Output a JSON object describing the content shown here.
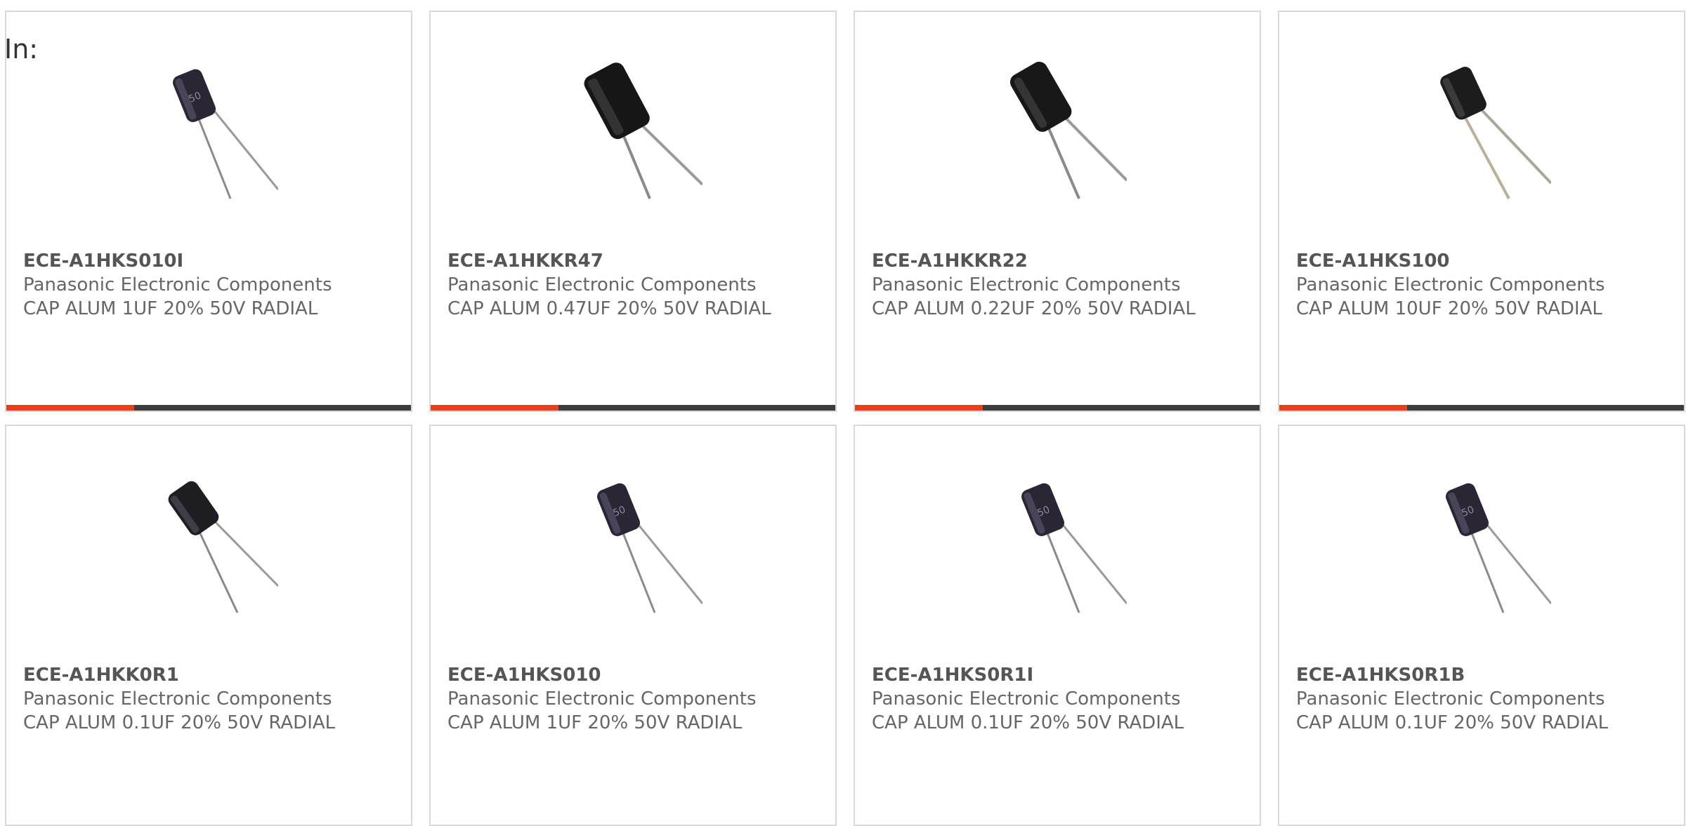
{
  "header": {
    "in_label": "In:"
  },
  "colors": {
    "accent": "#e8401c",
    "bar": "#3d3d3d",
    "border": "#d9d9d9",
    "text": "#666666"
  },
  "products": [
    {
      "part_number": "ECE-A1HKS010I",
      "manufacturer": "Panasonic Electronic Components",
      "description": "CAP ALUM 1UF 20% 50V RADIAL",
      "icon": "capacitor-icon"
    },
    {
      "part_number": "ECE-A1HKKR47",
      "manufacturer": "Panasonic Electronic Components",
      "description": "CAP ALUM 0.47UF 20% 50V RADIAL",
      "icon": "capacitor-icon"
    },
    {
      "part_number": "ECE-A1HKKR22",
      "manufacturer": "Panasonic Electronic Components",
      "description": "CAP ALUM 0.22UF 20% 50V RADIAL",
      "icon": "capacitor-icon"
    },
    {
      "part_number": "ECE-A1HKS100",
      "manufacturer": "Panasonic Electronic Components",
      "description": "CAP ALUM 10UF 20% 50V RADIAL",
      "icon": "capacitor-icon"
    },
    {
      "part_number": "ECE-A1HKK0R1",
      "manufacturer": "Panasonic Electronic Components",
      "description": "CAP ALUM 0.1UF 20% 50V RADIAL",
      "icon": "capacitor-icon"
    },
    {
      "part_number": "ECE-A1HKS010",
      "manufacturer": "Panasonic Electronic Components",
      "description": "CAP ALUM 1UF 20% 50V RADIAL",
      "icon": "capacitor-icon"
    },
    {
      "part_number": "ECE-A1HKS0R1I",
      "manufacturer": "Panasonic Electronic Components",
      "description": "CAP ALUM 0.1UF 20% 50V RADIAL",
      "icon": "capacitor-icon"
    },
    {
      "part_number": "ECE-A1HKS0R1B",
      "manufacturer": "Panasonic Electronic Components",
      "description": "CAP ALUM 0.1UF 20% 50V RADIAL",
      "icon": "capacitor-icon"
    }
  ]
}
